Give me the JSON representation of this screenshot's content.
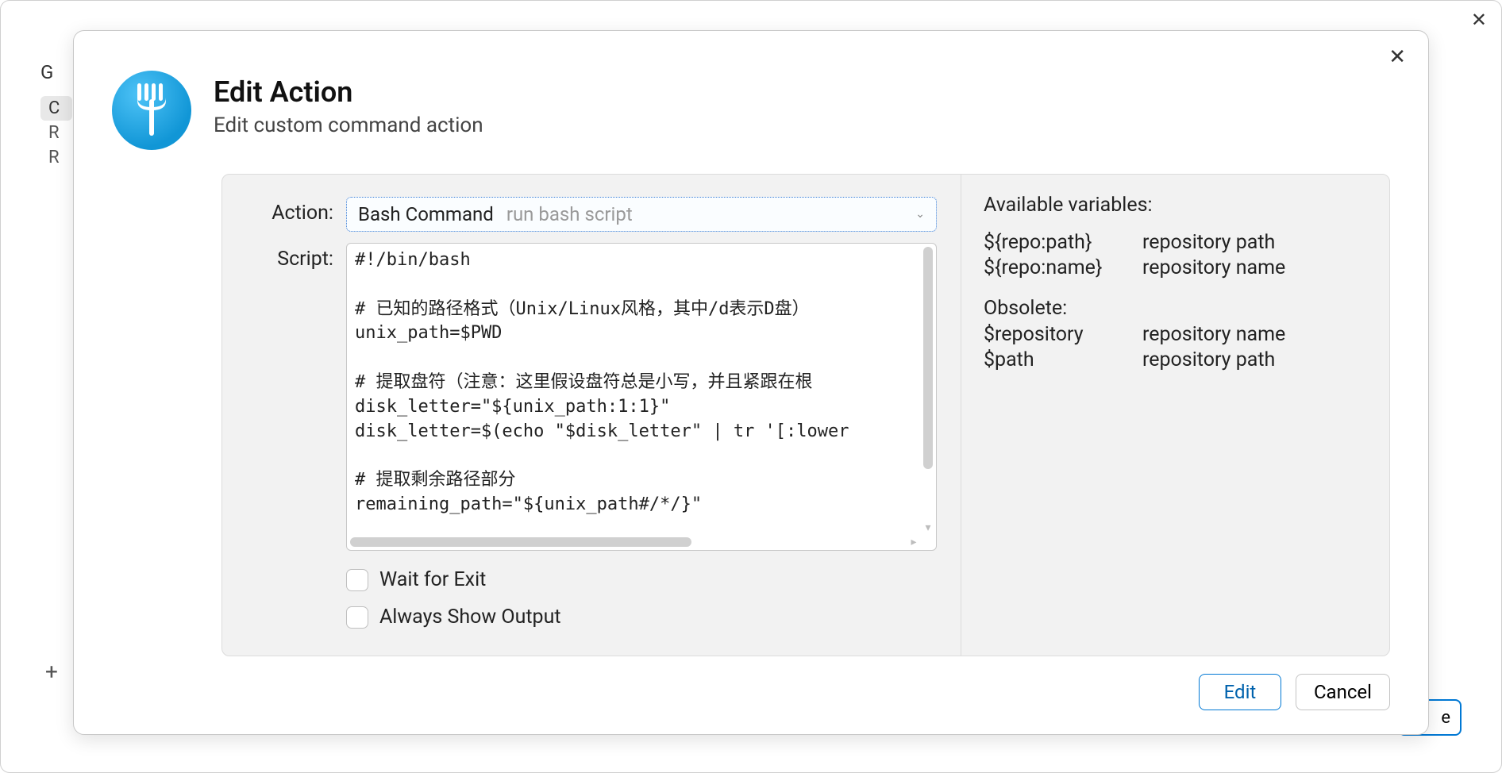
{
  "outer": {
    "sidebar_letter": "G",
    "bg_items": [
      "C",
      "R",
      "R"
    ],
    "bg_btn_partial": "e"
  },
  "modal": {
    "title": "Edit Action",
    "subtitle": "Edit custom command action",
    "action_label": "Action:",
    "action_value": "Bash Command",
    "action_hint": "run bash script",
    "script_label": "Script:",
    "script_text": "#!/bin/bash\n\n# 已知的路径格式（Unix/Linux风格，其中/d表示D盘）\nunix_path=$PWD\n\n# 提取盘符（注意：这里假设盘符总是小写，并且紧跟在根\ndisk_letter=\"${unix_path:1:1}\"\ndisk_letter=$(echo \"$disk_letter\" | tr '[:lower\n\n# 提取剩余路径部分\nremaining_path=\"${unix_path#/*/}\"",
    "wait_label": "Wait for Exit",
    "always_label": "Always Show Output",
    "vars_title": "Available variables:",
    "vars": [
      {
        "name": "${repo:path}",
        "desc": "repository path"
      },
      {
        "name": "${repo:name}",
        "desc": "repository name"
      }
    ],
    "obsolete_title": "Obsolete:",
    "obsolete": [
      {
        "name": "$repository",
        "desc": "repository name"
      },
      {
        "name": "$path",
        "desc": "repository path"
      }
    ],
    "edit_btn": "Edit",
    "cancel_btn": "Cancel"
  }
}
